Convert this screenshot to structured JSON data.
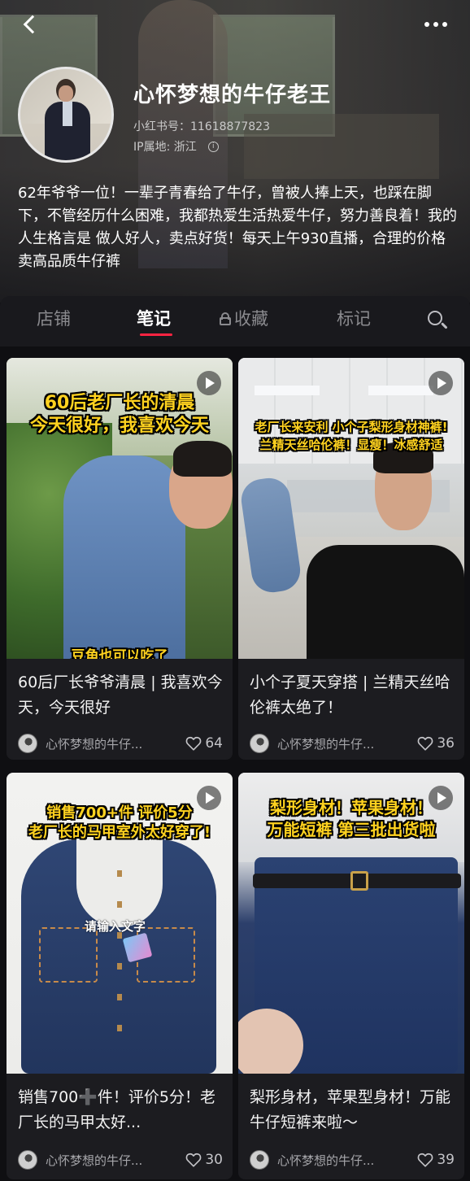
{
  "profile": {
    "name": "心怀梦想的牛仔老王",
    "xhs_id_label": "小红书号：11618877823",
    "ip_label": "IP属地: 浙江",
    "bio": "62年爷爷一位！一辈子青春给了牛仔，曾被人捧上天，也踩在脚下，不管经历什么困难，我都热爱生活热爱牛仔，努力善良着！我的人生格言是 做人好人，卖点好货！每天上午930直播，合理的价格卖高品质牛仔裤"
  },
  "tabs": [
    {
      "label": "店铺",
      "active": false
    },
    {
      "label": "笔记",
      "active": true
    },
    {
      "label": "收藏",
      "active": false
    },
    {
      "label": "标记",
      "active": false
    }
  ],
  "accent_color": "#ff2442",
  "notes": [
    {
      "overlay_lines": [
        "60后老厂长的清晨",
        "今天很好，我喜欢今天"
      ],
      "caption_bottom": "豆角也可以吃了",
      "title": "60后厂长爷爷清晨 | 我喜欢今天，今天很好",
      "author": "心怀梦想的牛仔...",
      "likes": "64"
    },
    {
      "overlay_lines": [
        "老厂长来安利 小个子梨形身材神裤!",
        "兰精天丝哈伦裤！显瘦！冰感舒适"
      ],
      "title": "小个子夏天穿搭 | 兰精天丝哈伦裤太绝了！",
      "author": "心怀梦想的牛仔...",
      "likes": "36"
    },
    {
      "overlay_lines": [
        "销售700+件 评价5分",
        "老厂长的马甲室外太好穿了!"
      ],
      "sticker": "请输入文字",
      "title": "销售700➕件！评价5分！老厂长的马甲太好...",
      "author": "心怀梦想的牛仔...",
      "likes": "30"
    },
    {
      "overlay_lines": [
        "梨形身材！苹果身材！",
        "万能短裤 第三批出货啦"
      ],
      "title": "梨形身材，苹果型身材！万能牛仔短裤来啦～",
      "author": "心怀梦想的牛仔...",
      "likes": "39"
    }
  ]
}
